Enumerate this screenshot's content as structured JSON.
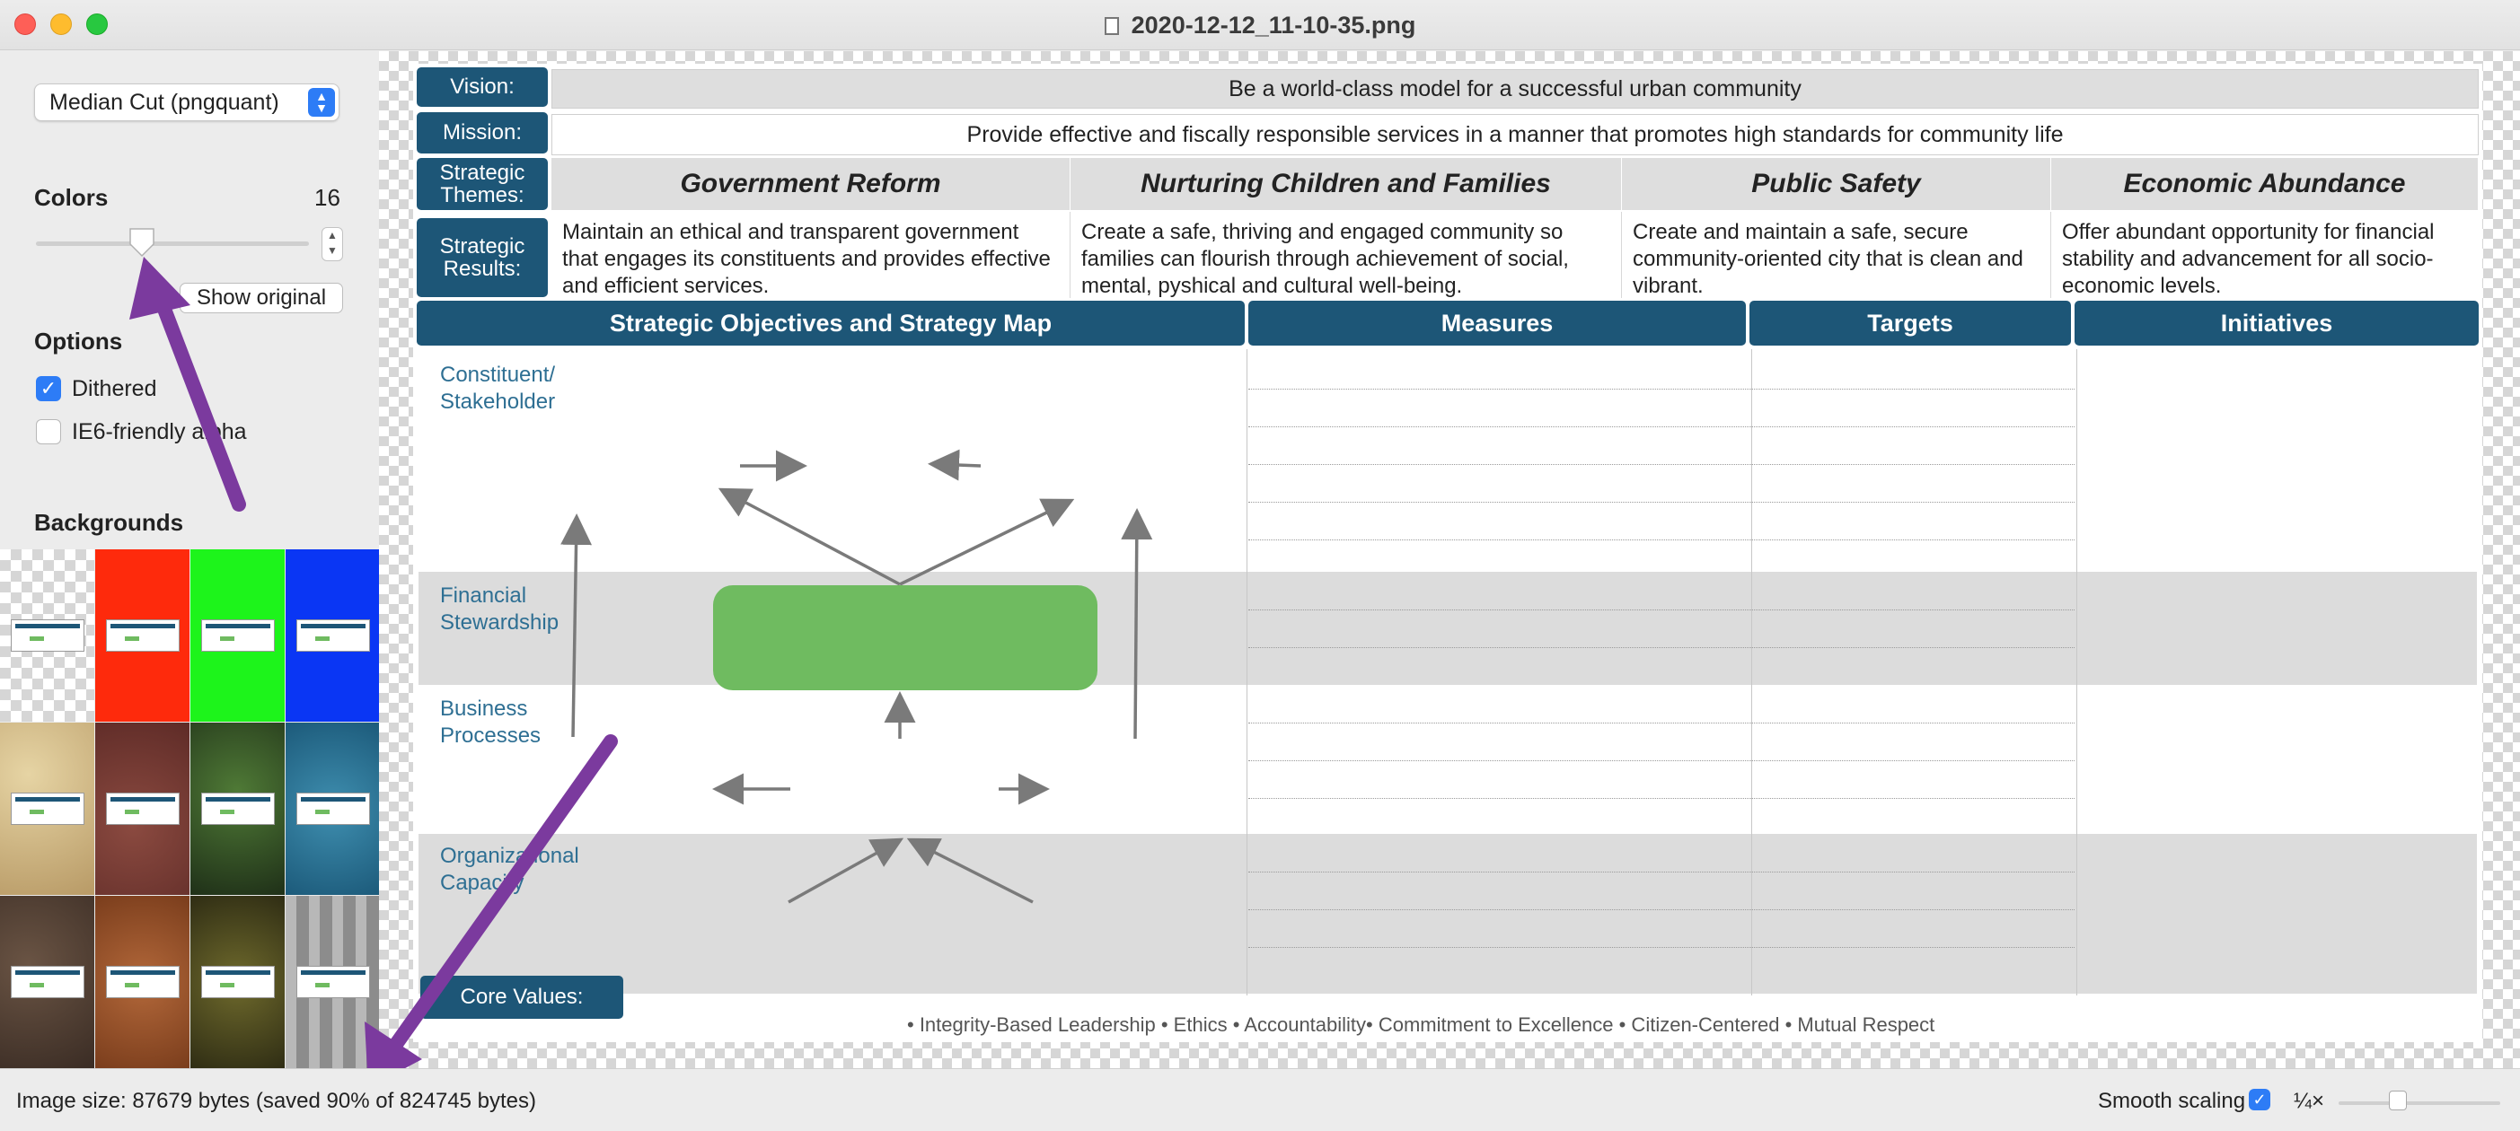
{
  "window": {
    "title": "2020-12-12_11-10-35.png"
  },
  "sidebar": {
    "algorithm": "Median Cut (pngquant)",
    "colors_label": "Colors",
    "colors_value": "16",
    "colors_slider_fraction": 0.3,
    "show_original": "Show original",
    "options_label": "Options",
    "options": [
      {
        "label": "Dithered",
        "checked": true
      },
      {
        "label": "IE6-friendly alpha",
        "checked": false
      }
    ],
    "backgrounds_label": "Backgrounds",
    "backgrounds": [
      "checkerboard",
      "red",
      "green",
      "blue",
      "sand",
      "dark-red-texture",
      "leaves",
      "water",
      "rocks",
      "rust",
      "moss",
      "metal-spikes"
    ]
  },
  "status": {
    "image_size": "Image size: 87679 bytes (saved 90% of 824745 bytes)",
    "smooth_scaling_label": "Smooth scaling",
    "smooth_scaling_checked": true,
    "zoom": "¼×"
  },
  "doc": {
    "vision_label": "Vision:",
    "vision": "Be a world-class model for a successful urban community",
    "mission_label": "Mission:",
    "mission": "Provide effective and fiscally responsible services in a manner that promotes high standards for community life",
    "themes_label": "Strategic Themes:",
    "themes": [
      "Government Reform",
      "Nurturing Children and Families",
      "Public Safety",
      "Economic Abundance"
    ],
    "results_label": "Strategic Results:",
    "results": [
      "Maintain an ethical and transparent government that engages its constituents and provides effective and efficient services.",
      "Create a safe, thriving and engaged community so families can flourish through achievement of social, mental, pyshical and cultural well-being.",
      "Create and maintain a safe, secure community-oriented city that is clean and vibrant.",
      "Offer abundant opportunity for financial stability and advancement for all socio-economic levels."
    ],
    "columns": [
      "Strategic Objectives and Strategy Map",
      "Measures",
      "Targets",
      "Initiatives"
    ],
    "perspectives": [
      "Constituent/ Stakeholder",
      "Financial Stewardship",
      "Business Processes",
      "Organizational Capacity"
    ],
    "core_values_label": "Core Values:",
    "core_values": "• Integrity-Based Leadership • Ethics • Accountability• Commitment to Excellence • Citizen-Centered • Mutual Respect"
  },
  "colors": {
    "header_blue": "#1d5677",
    "perspective_text": "#2e6f93",
    "green_box": "#6fbb60",
    "accent_blue": "#2d7cf6",
    "annotation_arrow": "#7b3a9e"
  }
}
